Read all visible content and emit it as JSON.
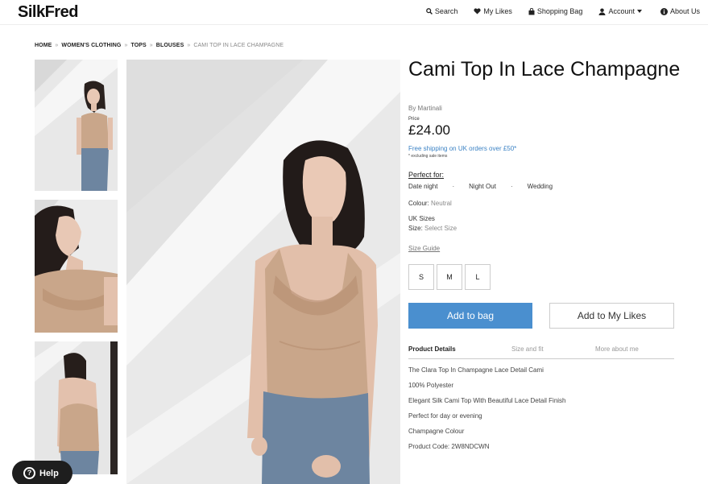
{
  "header": {
    "logo": "SilkFred",
    "nav": {
      "search": "Search",
      "likes": "My Likes",
      "bag": "Shopping Bag",
      "account": "Account",
      "about": "About Us"
    }
  },
  "breadcrumb": {
    "items": [
      "HOME",
      "WOMEN'S CLOTHING",
      "TOPS",
      "BLOUSES"
    ],
    "separator": "»",
    "current": "CAMI TOP IN LACE CHAMPAGNE"
  },
  "product": {
    "title": "Cami Top In Lace Champagne",
    "byline": "By Martinali",
    "price_label": "Price",
    "price": "£24.00",
    "shipping": "Free shipping on UK orders over £50*",
    "shipping_note": "* excluding sale items",
    "perfect_for_label": "Perfect for:",
    "perfect_for": [
      "Date night",
      "Night Out",
      "Wedding"
    ],
    "colour_label": "Colour:",
    "colour_value": "Neutral",
    "sizes_title": "UK Sizes",
    "size_label": "Size:",
    "size_value": "Select Size",
    "size_guide": "Size Guide",
    "sizes": [
      "S",
      "M",
      "L"
    ],
    "add_to_bag": "Add to bag",
    "add_to_likes": "Add to My Likes"
  },
  "tabs": {
    "details": "Product Details",
    "size_fit": "Size and fit",
    "more": "More about me"
  },
  "details": [
    "The Clara Top In Champagne Lace Detail Cami",
    "100% Polyester",
    "Elegant Silk Cami Top With Beautiful Lace Detail Finish",
    "Perfect for day or evening",
    "Champagne Colour",
    "Product Code: 2W8NDCWN"
  ],
  "help": {
    "label": "Help"
  },
  "colors": {
    "accent_blue": "#4a8fcf",
    "link_blue": "#3b82c4",
    "top_champagne": "#c9a68a",
    "wall": "#e9e9e9"
  }
}
